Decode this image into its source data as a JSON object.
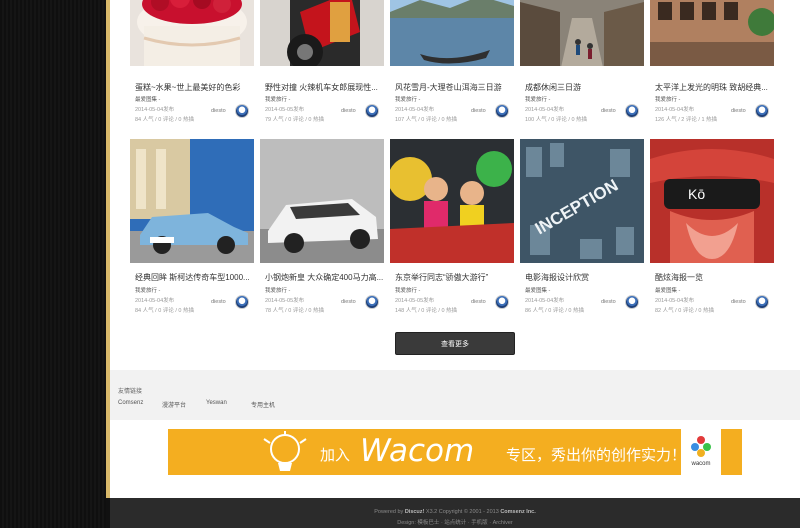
{
  "cards": [
    {
      "title": "蛋糕~水果~世上最美好的色彩",
      "category": "最爱图集 -",
      "date": "2014-05-04发布",
      "stats": "84 人气 / 0 评论 / 0 热描",
      "author": "diesto",
      "thumb": "dessert"
    },
    {
      "title": "野性对撞 火辣机车女郎展现性...",
      "category": "我爱旅行 -",
      "date": "2014-05-05发布",
      "stats": "79 人气 / 0 评论 / 0 热描",
      "author": "diesto",
      "thumb": "motorbike"
    },
    {
      "title": "风花雪月-大理苍山洱海三日游",
      "category": "我爱旅行 -",
      "date": "2014-05-04发布",
      "stats": "107 人气 / 0 评论 / 0 热描",
      "author": "diesto",
      "thumb": "lake"
    },
    {
      "title": "成都休闲三日游",
      "category": "我爱旅行 -",
      "date": "2014-05-04发布",
      "stats": "100 人气 / 0 评论 / 0 热描",
      "author": "diesto",
      "thumb": "street"
    },
    {
      "title": "太平洋上发光的明珠 致胡经典...",
      "category": "我爱旅行 -",
      "date": "2014-05-04发布",
      "stats": "126 人气 / 2 评论 / 1 热描",
      "author": "diesto",
      "thumb": "building"
    },
    {
      "title": "经典回眸 斯柯达传奇车型1000...",
      "category": "我爱旅行 -",
      "date": "2014-05-04发布",
      "stats": "84 人气 / 0 评论 / 0 热描",
      "author": "diesto",
      "thumb": "classic-car"
    },
    {
      "title": "小钢炮新皇 大众确定400马力高...",
      "category": "我爱旅行 -",
      "date": "2014-05-05发布",
      "stats": "78 人气 / 0 评论 / 0 热描",
      "author": "diesto",
      "thumb": "white-car"
    },
    {
      "title": "东京举行同志“骄傲大游行”",
      "category": "我爱旅行 -",
      "date": "2014-05-05发布",
      "stats": "148 人气 / 0 评论 / 0 热描",
      "author": "diesto",
      "thumb": "parade"
    },
    {
      "title": "电影海报设计欣赏",
      "category": "最爱图集 -",
      "date": "2014-05-04发布",
      "stats": "86 人气 / 0 评论 / 0 热描",
      "author": "diesto",
      "thumb": "inception"
    },
    {
      "title": "酷炫海报一览",
      "category": "最爱图集 -",
      "date": "2014-05-04发布",
      "stats": "82 人气 / 0 评论 / 0 热描",
      "author": "diesto",
      "thumb": "lips"
    }
  ],
  "more_button": "查看更多",
  "links": {
    "title": "友情链接",
    "items": [
      "Comsenz",
      "漫游平台",
      "Yeswan",
      "专用主机"
    ]
  },
  "banner": {
    "text_before": "加入",
    "brand": "Wacom",
    "text_after": "专区，秀出你的创作实力！",
    "badge_label": "wacom"
  },
  "footer": {
    "line1_prefix": "Powered by",
    "line1_product": "Discuz!",
    "line1_version": "X3.2",
    "line1_copyright": "Copyright © 2001 - 2013",
    "line1_company": "Comsenz Inc.",
    "line2": "Design: 模板巴士 · 站点统计 · 手机版 · Archiver"
  },
  "colors": {
    "accent": "#d9b96a",
    "banner": "#f4ae20",
    "button": "#3a3a3a",
    "footer": "#2b2b2b"
  }
}
